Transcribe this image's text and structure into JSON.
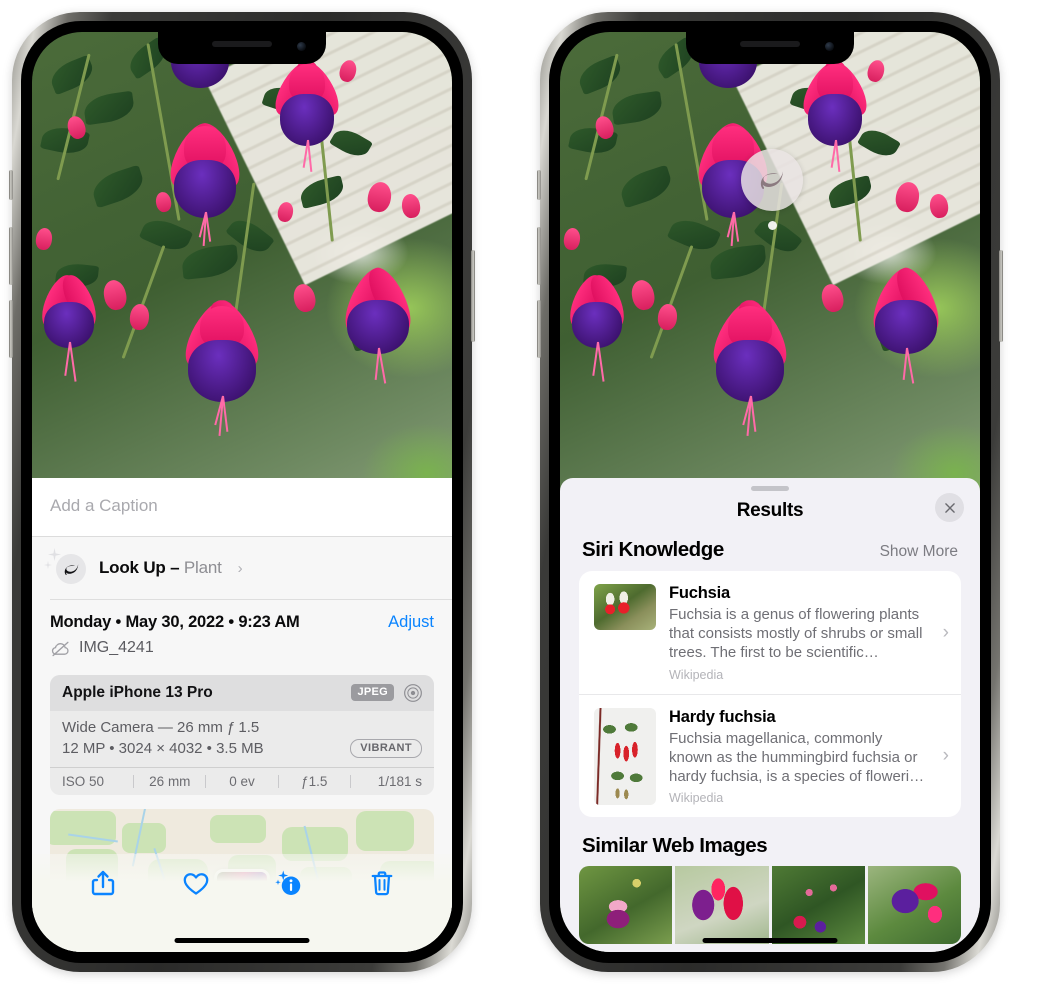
{
  "left_phone": {
    "caption": {
      "placeholder": "Add a Caption",
      "value": ""
    },
    "lookup": {
      "icon": "leaf-icon",
      "label": "Look Up – ",
      "subject": "Plant",
      "chevron": "›"
    },
    "date_info": {
      "date": "Monday • May 30, 2022 • 9:23 AM",
      "adjust_label": "Adjust",
      "cloud_icon": "icloud-slash-icon",
      "filename": "IMG_4241"
    },
    "exif": {
      "device": "Apple iPhone 13 Pro",
      "format_badge": "JPEG",
      "aperture_icon": "aperture-icon",
      "lens_line": "Wide Camera — 26 mm ƒ 1.5",
      "size_line": "12 MP • 3024 × 4032 • 3.5 MB",
      "style_badge": "VIBRANT",
      "stats": [
        "ISO 50",
        "26 mm",
        "0 ev",
        "ƒ1.5",
        "1/181 s"
      ]
    },
    "toolbar": [
      {
        "name": "share-button",
        "icon": "share-icon"
      },
      {
        "name": "favorite-button",
        "icon": "heart-icon"
      },
      {
        "name": "info-button",
        "icon": "info-sparkle-icon"
      },
      {
        "name": "delete-button",
        "icon": "trash-icon"
      }
    ]
  },
  "right_phone": {
    "badge": {
      "icon": "leaf-icon"
    },
    "sheet": {
      "title": "Results",
      "close_icon": "close-icon"
    },
    "siri_knowledge": {
      "title": "Siri Knowledge",
      "show_more": "Show More",
      "items": [
        {
          "title": "Fuchsia",
          "description": "Fuchsia is a genus of flowering plants that consists mostly of shrubs or small trees. The first to be scientific…",
          "source": "Wikipedia",
          "chevron": "›"
        },
        {
          "title": "Hardy fuchsia",
          "description": "Fuchsia magellanica, commonly known as the hummingbird fuchsia or hardy fuchsia, is a species of floweri…",
          "source": "Wikipedia",
          "chevron": "›"
        }
      ]
    },
    "similar_web_images": {
      "title": "Similar Web Images",
      "count": 4
    }
  },
  "colors": {
    "accent_blue": "#0a84ff",
    "sheet_bg": "#f2f1f6",
    "info_bg": "#f7f7f7",
    "card_bg": "#ffffff",
    "secondary_text": "#8e8e93"
  }
}
